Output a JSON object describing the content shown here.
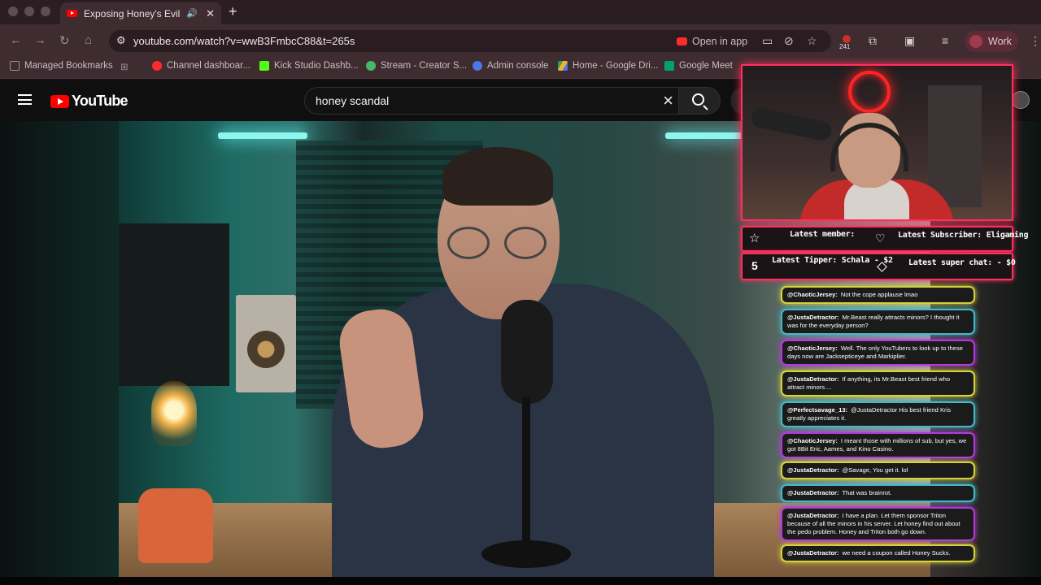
{
  "browser": {
    "tab": {
      "title": "Exposing Honey's Evil Bus",
      "close_glyph": "✕",
      "speaker_glyph": "🔊"
    },
    "new_tab_glyph": "+",
    "url": "youtube.com/watch?v=wwB3FmbcC88&t=265s",
    "open_in_app": "Open in app",
    "extension_badge": "241",
    "profile_label": "Work",
    "bookmarks": [
      {
        "label": "Managed Bookmarks",
        "icon": "folder-icon",
        "color": "#9d9094"
      },
      {
        "label": "Channel dashboar...",
        "icon": "youtube-icon",
        "color": "#ff2b2b"
      },
      {
        "label": "Kick Studio Dashb...",
        "icon": "kick-icon",
        "color": "#53fc18"
      },
      {
        "label": "Stream - Creator S...",
        "icon": "stream-icon",
        "color": "#45b86a"
      },
      {
        "label": "Admin console",
        "icon": "admin-icon",
        "color": "#4a78e8"
      },
      {
        "label": "Home - Google Dri...",
        "icon": "drive-icon",
        "color": "#f0b429"
      },
      {
        "label": "Google Meet",
        "icon": "meet-icon",
        "color": "#00a36c"
      }
    ]
  },
  "youtube": {
    "logo_text": "YouTube",
    "search_query": "honey scandal"
  },
  "overlay": {
    "latest_member": "Latest member:",
    "latest_subscriber": "Latest Subscriber: Eligaming",
    "latest_tipper": "Latest Tipper: Schala - $2",
    "latest_superchat": "Latest super chat:  - $0",
    "tipper_rank": "5"
  },
  "chat": [
    {
      "user": "@ChaoticJersey:",
      "text": "Not the cope applause lmao",
      "color": "yellow"
    },
    {
      "user": "@JustaDetractor:",
      "text": "Mr.Beast really attracts minors? I thought it was for the everyday person?",
      "color": "teal"
    },
    {
      "user": "@ChaoticJersey:",
      "text": "Well. The only YouTubers to look up to these days now are Jacksepticeye and Markiplier.",
      "color": "purple"
    },
    {
      "user": "@JustaDetractor:",
      "text": "If anything, its Mr.Beast best friend who attract minors....",
      "color": "yellow"
    },
    {
      "user": "@Perfectsavage_13:",
      "text": "@JustaDetractor His best friend Kris greatly appreciates it.",
      "color": "teal"
    },
    {
      "user": "@ChaoticJersey:",
      "text": "I meant those with millions of sub, but yes, we got 8Bit Eric, Aames, and Kino Casino.",
      "color": "purple"
    },
    {
      "user": "@JustaDetractor:",
      "text": "@Savage, You get it. lol",
      "color": "yellow"
    },
    {
      "user": "@JustaDetractor:",
      "text": "That was brainrot.",
      "color": "teal"
    },
    {
      "user": "@JustaDetractor:",
      "text": "I have a plan. Let them sponsor Triton because of all the minors in his server. Let honey find out about the pedo problem. Honey and Triton both go down.",
      "color": "purple"
    },
    {
      "user": "@JustaDetractor:",
      "text": "we need a coupon called Honey Sucks.",
      "color": "yellow"
    }
  ]
}
